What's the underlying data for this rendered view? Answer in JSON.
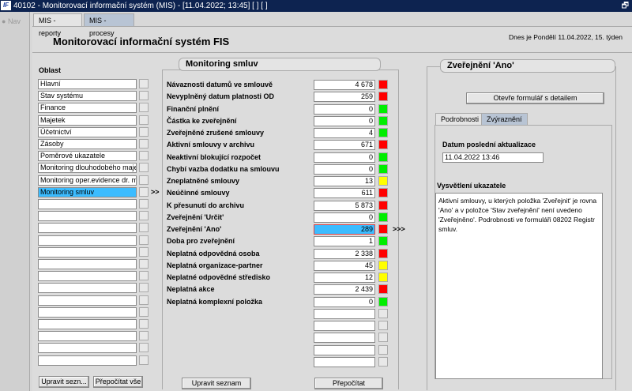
{
  "window": {
    "title": "40102 - Monitorovací informační systém (MIS) - [11.04.2022; 13:45]  [ ] [ ]",
    "logo": "IF",
    "restore_icon": "restore-icon"
  },
  "nav": {
    "label": "Nav"
  },
  "tabs": [
    {
      "label": "MIS - reporty"
    },
    {
      "label": "MIS - procesy"
    }
  ],
  "header": {
    "title": "Monitorovací informační systém FIS",
    "date": "Dnes je Pondělí 11.04.2022, 15. týden"
  },
  "oblast": {
    "label": "Oblast",
    "items": [
      "Hlavní",
      "Stav systému",
      "Finance",
      "Majetek",
      "Účetnictví",
      "Zásoby",
      "Poměrové ukazatele",
      "Monitoring dlouhodobého majetk",
      "Monitoring oper.evidence dr. ma",
      "Monitoring smluv"
    ],
    "selected": 9,
    "empty_rows": 14,
    "arrow": ">>",
    "edit_button": "Upravit sezn...",
    "recalc_all_button": "Přepočítat vše"
  },
  "monitoring": {
    "title": "Monitoring smluv",
    "rows": [
      {
        "label": "Návaznosti datumů ve smlouvě",
        "value": "4 678",
        "status": "red"
      },
      {
        "label": "Nevyplněný datum platnosti OD",
        "value": "259",
        "status": "red"
      },
      {
        "label": "Finanční plnění",
        "value": "0",
        "status": "green"
      },
      {
        "label": "Částka ke zveřejnění",
        "value": "0",
        "status": "green"
      },
      {
        "label": "Zveřejněné zrušené smlouvy",
        "value": "4",
        "status": "green"
      },
      {
        "label": "Aktivní smlouvy v archivu",
        "value": "671",
        "status": "red"
      },
      {
        "label": "Neaktivní blokující rozpočet",
        "value": "0",
        "status": "green"
      },
      {
        "label": "Chybí vazba dodatku na smlouvu",
        "value": "0",
        "status": "green"
      },
      {
        "label": "Zneplatněné smlouvy",
        "value": "13",
        "status": "yellow"
      },
      {
        "label": "Neúčinné smlouvy",
        "value": "611",
        "status": "red"
      },
      {
        "label": "K přesunutí do archivu",
        "value": "5 873",
        "status": "red"
      },
      {
        "label": "Zveřejnění 'Určit'",
        "value": "0",
        "status": "green"
      },
      {
        "label": "Zveřejnění 'Ano'",
        "value": "289",
        "status": "red"
      },
      {
        "label": "Doba pro zveřejnění",
        "value": "1",
        "status": "green"
      },
      {
        "label": "Neplatná odpovědná osoba",
        "value": "2 338",
        "status": "red"
      },
      {
        "label": "Neplatná organizace-partner",
        "value": "45",
        "status": "yellow"
      },
      {
        "label": "Neplatné odpovědné středisko",
        "value": "12",
        "status": "yellow"
      },
      {
        "label": "Neplatná akce",
        "value": "2 439",
        "status": "red"
      },
      {
        "label": "Neplatná komplexní položka",
        "value": "0",
        "status": "green"
      }
    ],
    "selected": 12,
    "arrow": ">>>",
    "empty_rows": 5,
    "edit_button": "Upravit seznam",
    "recalc_button": "Přepočítat"
  },
  "colors": {
    "red": "#ff0000",
    "green": "#00ee00",
    "yellow": "#ffff00",
    "selected": "#3cbcff",
    "titlebar": "#0d2350"
  },
  "detail": {
    "title": "Zveřejnění 'Ano'",
    "open_button": "Otevře formulář s detailem",
    "tabs": [
      {
        "label": "Podrobnosti"
      },
      {
        "label": "Zvýraznění"
      }
    ],
    "date_label": "Datum poslední aktualizace",
    "date_value": "11.04.2022 13:46",
    "explain_label": "Vysvětlení ukazatele",
    "explain_text": "Aktivní smlouvy, u kterých položka 'Zveřejnit' je rovna 'Ano' a v  položce 'Stav zveřejnění' není uvedeno 'Zveřejněno'.  Podrobnosti ve formuláři 08202 Registr smluv."
  }
}
